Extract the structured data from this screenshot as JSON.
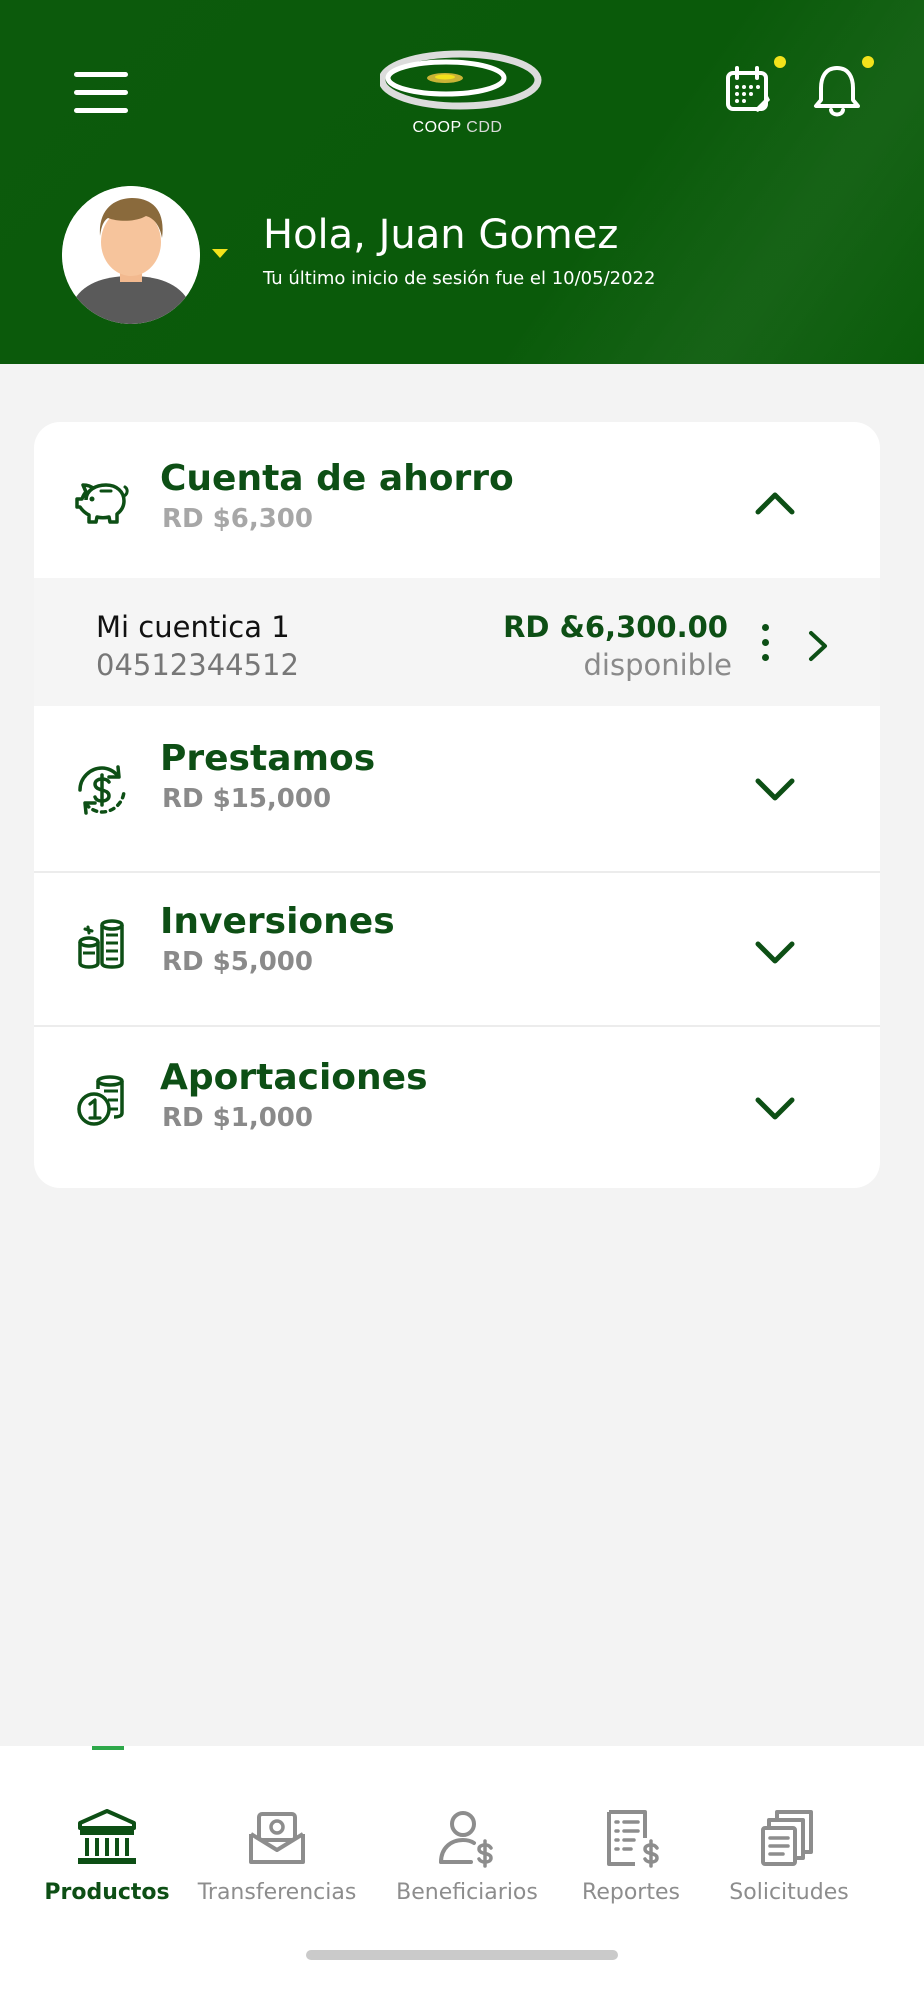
{
  "header": {
    "logo_text_main": "COOP",
    "logo_text_sub": "CDD",
    "greeting": "Hola, Juan Gomez",
    "last_login": "Tu último inicio de sesión fue el 10/05/2022",
    "accent_color": "#f2e21b",
    "background_color": "#0b5b0b",
    "icons": [
      "menu-icon",
      "calendar-icon",
      "bell-icon"
    ]
  },
  "products": {
    "sections": [
      {
        "title": "Cuenta de ahorro",
        "amount": "RD $6,300",
        "icon": "piggy-bank-icon",
        "expanded": true
      },
      {
        "title": "Prestamos",
        "amount": "RD $15,000",
        "icon": "loan-dollar-icon",
        "expanded": false
      },
      {
        "title": "Inversiones",
        "amount": "RD $5,000",
        "icon": "coin-stack-icon",
        "expanded": false
      },
      {
        "title": "Aportaciones",
        "amount": "RD $1,000",
        "icon": "coins-contribution-icon",
        "expanded": false
      }
    ],
    "savings_accounts": [
      {
        "name": "Mi cuentica 1",
        "number": "04512344512",
        "balance": "RD &6,300.00",
        "status": "disponible"
      }
    ]
  },
  "nav": {
    "items": [
      {
        "label": "Productos",
        "icon": "bank-icon",
        "active": true
      },
      {
        "label": "Transferencias",
        "icon": "money-envelope-icon",
        "active": false
      },
      {
        "label": "Beneficiarios",
        "icon": "user-dollar-icon",
        "active": false
      },
      {
        "label": "Reportes",
        "icon": "report-dollar-icon",
        "active": false
      },
      {
        "label": "Solicitudes",
        "icon": "documents-icon",
        "active": false
      }
    ],
    "active_color": "#0d4f15",
    "inactive_color": "#8d8d8d"
  }
}
